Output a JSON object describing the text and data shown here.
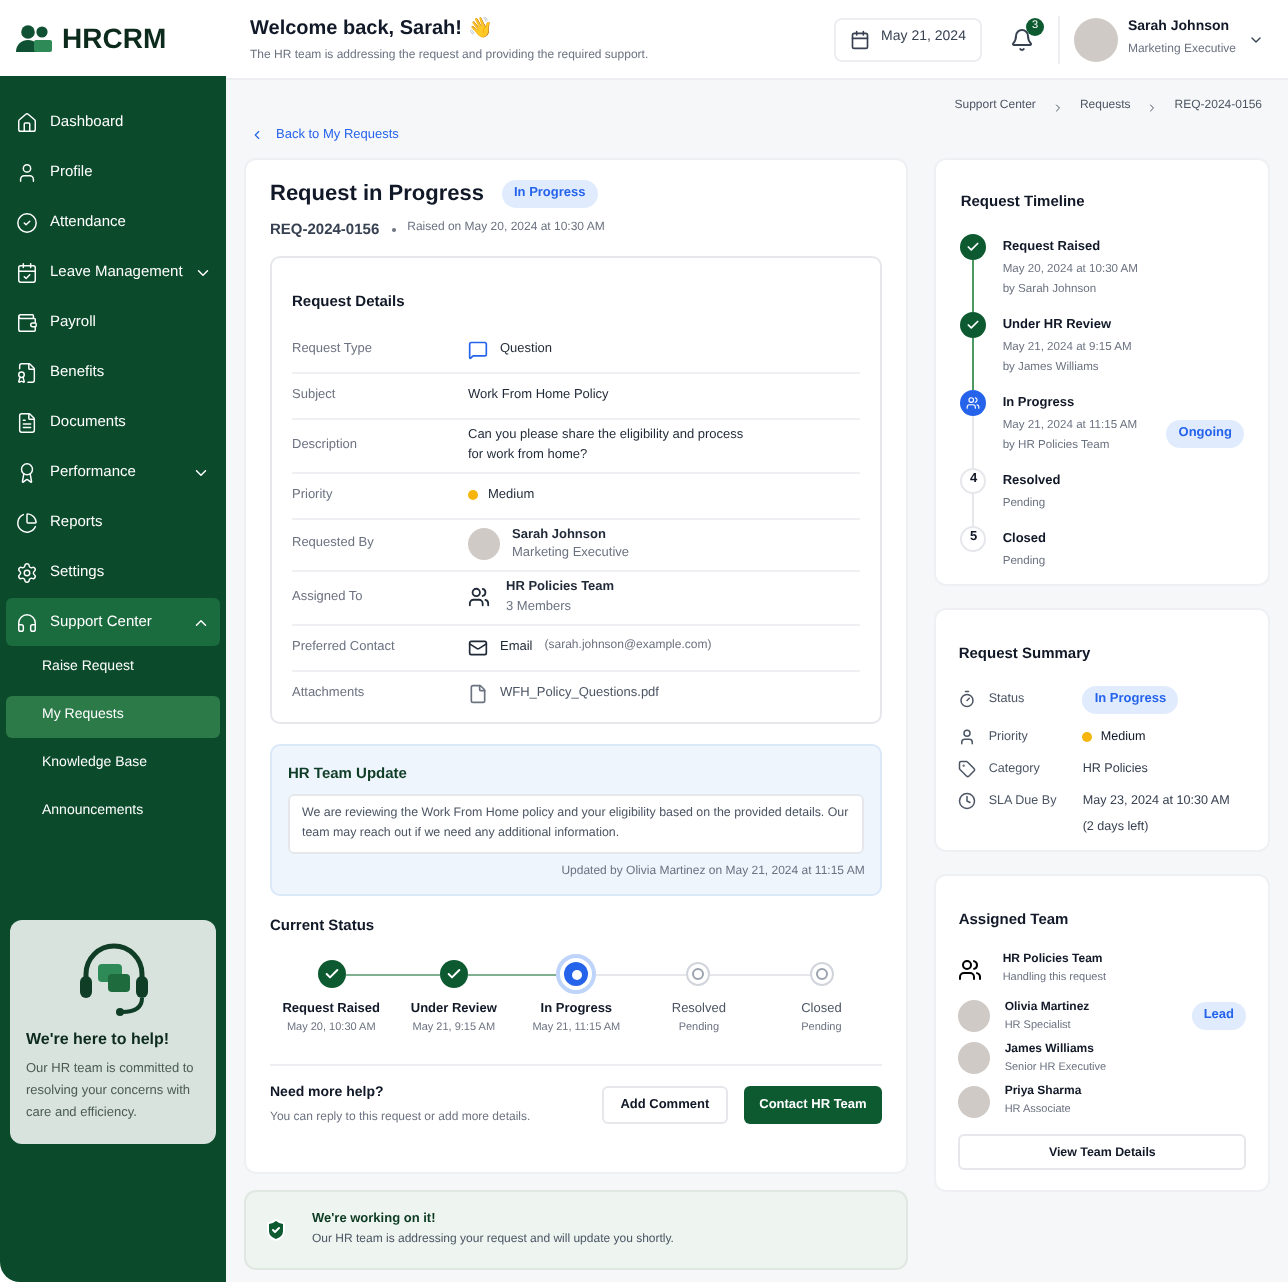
{
  "brand": {
    "name": "HRCRM"
  },
  "sidebar": {
    "items": [
      {
        "label": "Dashboard",
        "selected": false
      },
      {
        "label": "Profile",
        "selected": false
      },
      {
        "label": "Attendance",
        "selected": false
      },
      {
        "label": "Leave Management",
        "selected": false,
        "expanded": false
      },
      {
        "label": "Payroll",
        "selected": false
      },
      {
        "label": "Benefits",
        "selected": false
      },
      {
        "label": "Documents",
        "selected": false
      },
      {
        "label": "Performance",
        "selected": false,
        "expanded": false
      },
      {
        "label": "Reports",
        "selected": false
      },
      {
        "label": "Settings",
        "selected": false
      },
      {
        "label": "Support Center",
        "selected": true,
        "expanded": true,
        "children": [
          {
            "label": "Raise Request",
            "selected": false
          },
          {
            "label": "My Requests",
            "selected": true
          },
          {
            "label": "Knowledge Base",
            "selected": false
          },
          {
            "label": "Announcements",
            "selected": false
          }
        ]
      }
    ]
  },
  "help_card": {
    "title": "We're here to help!",
    "text": "Our HR team is committed to resolving your concerns with care and efficiency."
  },
  "header": {
    "title": "Welcome back, Sarah! 👋",
    "subtitle": "The HR team is addressing the request and providing the required support.",
    "date": "May 21, 2024",
    "notifications": "3",
    "user": {
      "name": "Sarah Johnson",
      "role": "Marketing Executive"
    }
  },
  "breadcrumb": [
    "Support Center",
    "Requests",
    "REQ-2024-0156"
  ],
  "back_link": "Back to My Requests",
  "request": {
    "title": "Request in Progress",
    "status": "In Progress",
    "id": "REQ-2024-0156",
    "raised": "Raised on May 20, 2024 at 10:30 AM"
  },
  "details": {
    "title": "Request Details",
    "rows": [
      {
        "kind": "type",
        "label": "Request Type",
        "value": "Question"
      },
      {
        "kind": "text",
        "label": "Subject",
        "value": "Work From Home Policy"
      },
      {
        "kind": "text",
        "label": "Description",
        "value": "Can you please share the eligibility and process for work from home?"
      },
      {
        "kind": "priority",
        "label": "Priority",
        "value": "Medium"
      },
      {
        "kind": "person",
        "label": "Requested By",
        "value": "Sarah Johnson",
        "sub": "Marketing Executive"
      },
      {
        "kind": "team",
        "label": "Assigned To",
        "value": "HR Policies Team",
        "sub": "3 Members"
      },
      {
        "kind": "contact",
        "label": "Preferred Contact",
        "value": "Email",
        "sub": "(sarah.johnson@example.com)"
      },
      {
        "kind": "file",
        "label": "Attachments",
        "value": "WFH_Policy_Questions.pdf"
      }
    ]
  },
  "update": {
    "title": "HR Team Update",
    "text": "We are reviewing the Work From Home policy and your eligibility based on the provided details. Our team may reach out if we need any additional information.",
    "footer": "Updated by Olivia Martinez on May 21, 2024 at 11:15 AM"
  },
  "current_status": {
    "title": "Current Status",
    "steps": [
      {
        "label": "Request Raised",
        "date": "May 20, 10:30 AM",
        "completed": true
      },
      {
        "label": "Under Review",
        "date": "May 21, 9:15 AM",
        "completed": true
      },
      {
        "label": "In Progress",
        "date": "May 21, 11:15 AM",
        "completed": false
      },
      {
        "label": "Resolved",
        "date": "Pending",
        "completed": false
      },
      {
        "label": "Closed",
        "date": "Pending",
        "completed": false
      }
    ]
  },
  "more_help": {
    "title": "Need more help?",
    "text": "You can reply to this request or add more details.",
    "buttons": [
      {
        "label": "Add Comment",
        "kind": "secondary"
      },
      {
        "label": "Contact HR Team",
        "kind": "primary"
      }
    ]
  },
  "notice": {
    "title": "We're working on it!",
    "text": "Our HR team is addressing your request and will update you shortly."
  },
  "timeline": {
    "title": "Request Timeline",
    "items": [
      {
        "title": "Request Raised",
        "lines": [
          "May 20, 2024 at 10:30 AM",
          "by Sarah Johnson"
        ],
        "completed": true
      },
      {
        "title": "Under HR Review",
        "lines": [
          "May 21, 2024 at 9:15 AM",
          "by James Williams"
        ],
        "completed": true
      },
      {
        "title": "In Progress",
        "lines": [
          "May 21, 2024 at 11:15 AM",
          "by HR Policies Team"
        ],
        "completed": false,
        "badge": "Ongoing"
      },
      {
        "title": "Resolved",
        "lines": [
          "Pending"
        ],
        "completed": false,
        "marker": "4"
      },
      {
        "title": "Closed",
        "lines": [
          "Pending"
        ],
        "completed": false,
        "marker": "5"
      }
    ]
  },
  "summary": {
    "title": "Request Summary",
    "rows": [
      {
        "kind": "badge",
        "label": "Status",
        "value": "In Progress"
      },
      {
        "kind": "priority",
        "label": "Priority",
        "value": "Medium"
      },
      {
        "kind": "text",
        "label": "Category",
        "value": "HR Policies"
      },
      {
        "kind": "text",
        "label": "SLA Due By",
        "value": "May 23, 2024 at 10:30 AM",
        "sub": "(2 days left)"
      }
    ]
  },
  "team": {
    "title": "Assigned Team",
    "group": {
      "name": "HR Policies Team",
      "sub": "Handling this request"
    },
    "members": [
      {
        "name": "Olivia Martinez",
        "role": "HR Specialist",
        "badge": "Lead"
      },
      {
        "name": "James Williams",
        "role": "Senior HR Executive"
      },
      {
        "name": "Priya Sharma",
        "role": "HR Associate"
      }
    ],
    "button": "View Team Details"
  }
}
